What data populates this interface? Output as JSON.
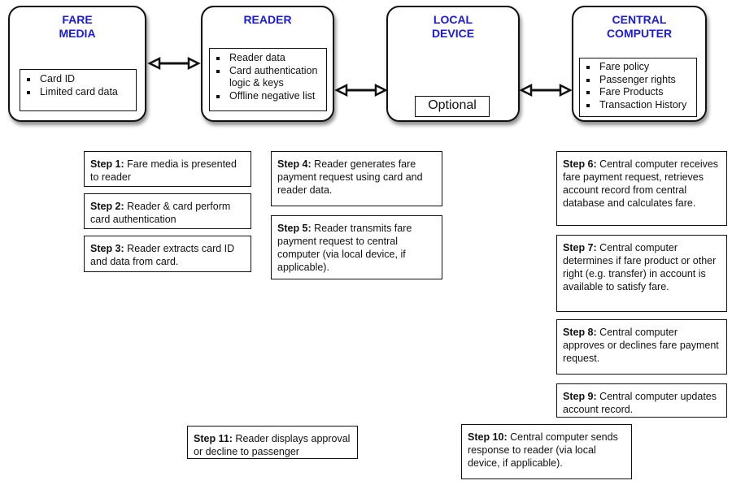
{
  "components": [
    {
      "title": "FARE\nMEDIA",
      "items": [
        "Card ID",
        "Limited card data"
      ]
    },
    {
      "title": "READER",
      "items": [
        "Reader data",
        "Card authentication logic & keys",
        "Offline negative list"
      ]
    },
    {
      "title": "LOCAL\nDEVICE",
      "label": "Optional"
    },
    {
      "title": "CENTRAL\nCOMPUTER",
      "items": [
        "Fare policy",
        "Passenger rights",
        "Fare Products",
        "Transaction History"
      ]
    }
  ],
  "steps": [
    {
      "label": "Step 1:",
      "text": " Fare media is presented to reader"
    },
    {
      "label": "Step 2:",
      "text": " Reader & card perform card authentication"
    },
    {
      "label": "Step 3:",
      "text": " Reader extracts card ID and data from card."
    },
    {
      "label": "Step 4:",
      "text": " Reader generates fare payment request using card and reader data."
    },
    {
      "label": "Step 5:",
      "text": " Reader transmits fare payment request to central computer (via local device, if applicable)."
    },
    {
      "label": "Step 6:",
      "text": " Central computer receives fare payment request, retrieves account record from central database and calculates fare."
    },
    {
      "label": "Step 7:",
      "text": " Central computer determines if fare product or other right (e.g. transfer) in account is available to satisfy fare."
    },
    {
      "label": "Step 8:",
      "text": " Central computer approves or declines fare payment request."
    },
    {
      "label": "Step 9:",
      "text": " Central computer updates account record."
    },
    {
      "label": "Step 10:",
      "text": " Central computer sends response to reader (via local device, if applicable)."
    },
    {
      "label": "Step 11:",
      "text": " Reader displays approval or decline to passenger"
    }
  ],
  "colors": {
    "title": "#1a1ae0",
    "border": "#111111"
  }
}
